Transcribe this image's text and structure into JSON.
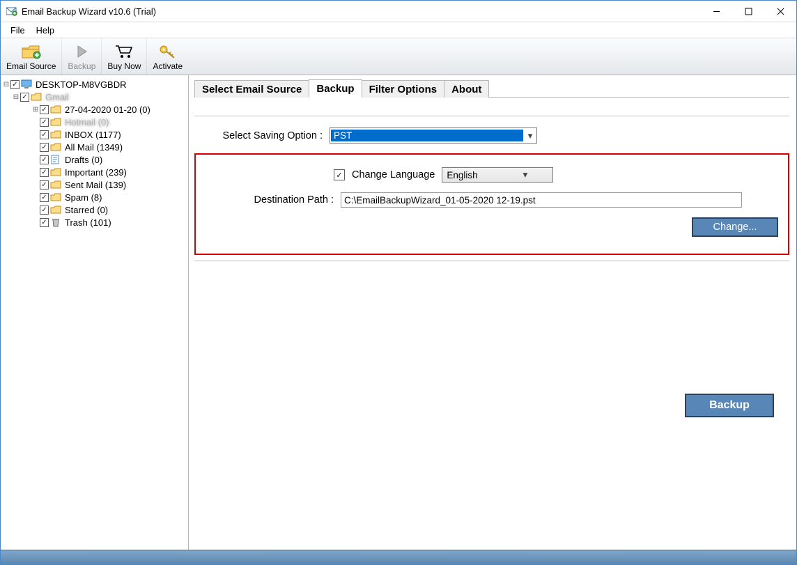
{
  "titlebar": {
    "title": "Email Backup Wizard v10.6 (Trial)"
  },
  "menu": {
    "file": "File",
    "help": "Help"
  },
  "toolbar": {
    "emailsource": "Email Source",
    "backup": "Backup",
    "buynow": "Buy Now",
    "activate": "Activate"
  },
  "tree": {
    "root": "DESKTOP-M8VGBDR",
    "account": "Gmail",
    "items": [
      "27-04-2020 01-20 (0)",
      "Hotmail (0)",
      "INBOX (1177)",
      "All Mail (1349)",
      "Drafts (0)",
      "Important (239)",
      "Sent Mail (139)",
      "Spam (8)",
      "Starred (0)",
      "Trash (101)"
    ]
  },
  "tabs": {
    "source": "Select Email Source",
    "backup": "Backup",
    "filter": "Filter Options",
    "about": "About"
  },
  "form": {
    "saving_label": "Select Saving Option :",
    "saving_value": "PST",
    "change_lang_label": "Change Language",
    "language_value": "English",
    "dest_label": "Destination Path :",
    "dest_value": "C:\\EmailBackupWizard_01-05-2020 12-19.pst",
    "change_btn": "Change...",
    "backup_btn": "Backup"
  }
}
